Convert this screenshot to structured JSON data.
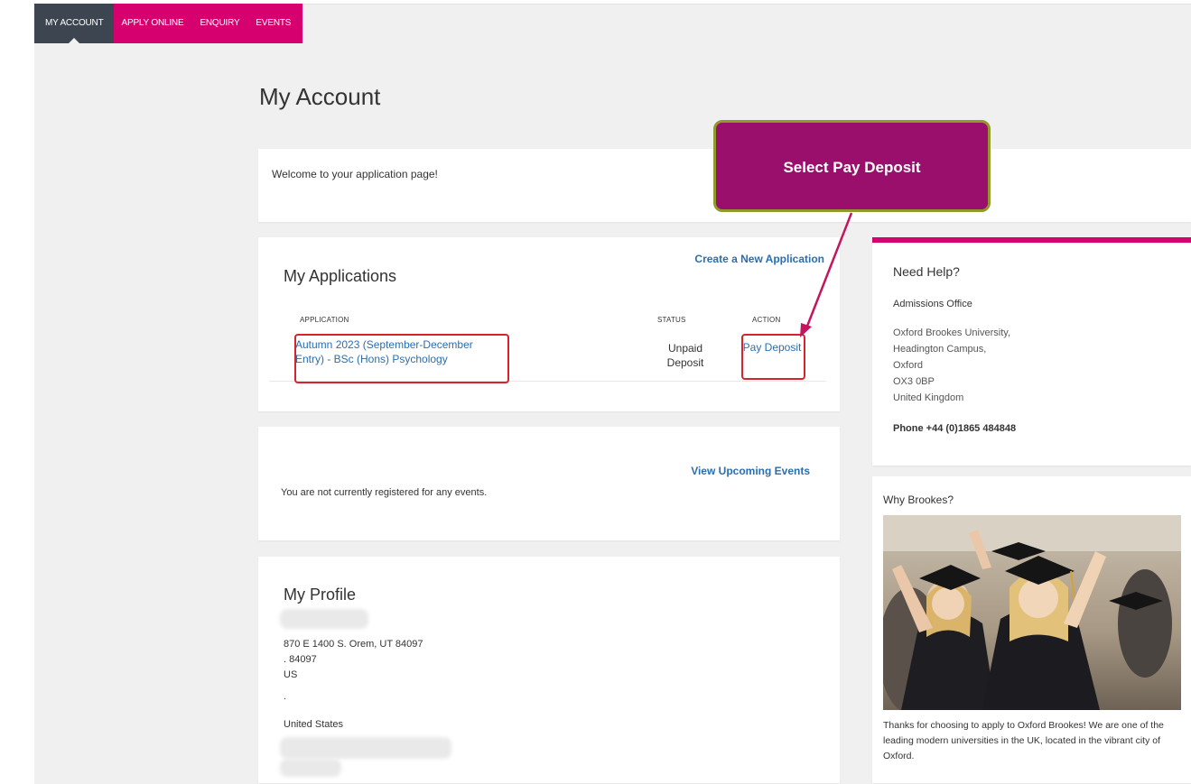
{
  "nav": {
    "items": [
      {
        "label": "MY ACCOUNT"
      },
      {
        "label": "APPLY ONLINE"
      },
      {
        "label": "ENQUIRY"
      },
      {
        "label": "EVENTS"
      }
    ]
  },
  "page": {
    "title": "My Account"
  },
  "welcome": {
    "text": "Welcome to your application page!"
  },
  "applications": {
    "title": "My Applications",
    "create_link": "Create a New Application",
    "headers": {
      "application": "APPLICATION",
      "status": "STATUS",
      "action": "ACTION"
    },
    "rows": [
      {
        "application": "Autumn 2023 (September-December Entry) - BSc (Hons) Psychology",
        "status": "Unpaid Deposit",
        "action": "Pay Deposit"
      }
    ]
  },
  "events": {
    "view_link": "View Upcoming Events",
    "message": "You are not currently registered for any events."
  },
  "profile": {
    "title": "My Profile",
    "address_line1": "870 E 1400 S. Orem, UT 84097",
    "address_line2": ". 84097",
    "address_line3": "US",
    "address_line4": ".",
    "country": "United States"
  },
  "help": {
    "title": "Need Help?",
    "office": "Admissions Office",
    "address": [
      "Oxford Brookes University,",
      "Headington Campus,",
      "Oxford",
      "OX3 0BP",
      "United Kingdom"
    ],
    "phone": "Phone +44 (0)1865 484848"
  },
  "why": {
    "title": "Why Brookes?",
    "caption": "Thanks for choosing to apply to Oxford Brookes! We are one of the leading modern universities in the UK, located in the vibrant city of Oxford."
  },
  "callout": {
    "text": "Select Pay Deposit"
  },
  "colors": {
    "brand_pink": "#d6006f",
    "nav_dark": "#3d4650",
    "link_blue": "#2a6eb0",
    "highlight_red": "#d8232a",
    "callout_purple": "#9a0f6c"
  }
}
